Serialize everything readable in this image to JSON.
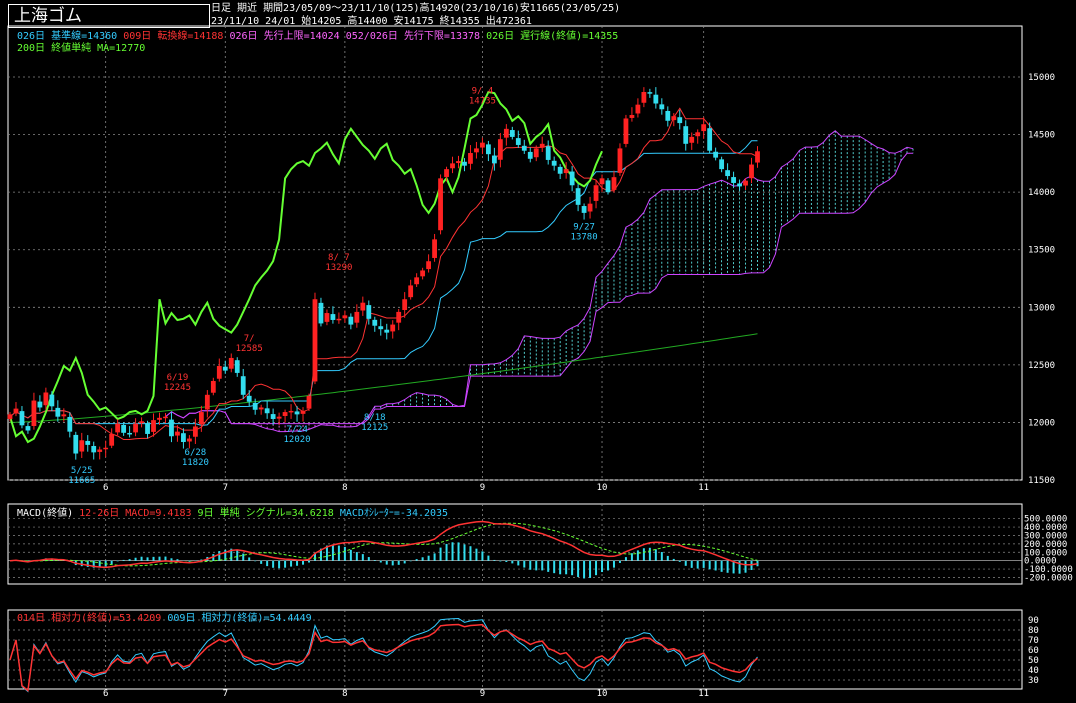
{
  "header": {
    "title": "上海ゴム",
    "period_label": "日足",
    "contract": "期近",
    "range": "期間23/05/09〜23/11/10(125)",
    "high": "高14920(23/10/16)",
    "low": "安11665(23/05/25)",
    "last_bar": "23/11/10 24/01 始14205 高14400 安14175 終14355 出472361"
  },
  "legend_main": [
    {
      "text": "026日 基準線=14360",
      "color": "#33ccff"
    },
    {
      "text": "009日 転換線=14188",
      "color": "#ff3333"
    },
    {
      "text": "026日 先行上限=14024",
      "color": "#ff66ff"
    },
    {
      "text": "052/026日 先行下限=13378",
      "color": "#ff66ff"
    },
    {
      "text": "026日 遅行線(終値)=14355",
      "color": "#66ff33"
    }
  ],
  "legend_main2": {
    "text": "200日 終値単純 MA=12770",
    "color": "#66ff33"
  },
  "legend_macd": [
    {
      "text": "MACD(終値)",
      "color": "#ffffff"
    },
    {
      "text": "12-26日 MACD=9.4183",
      "color": "#ff3333"
    },
    {
      "text": "9日 単純 シグナル=34.6218",
      "color": "#66ff33"
    },
    {
      "text": "MACDｵｼﾚｰﾀｰ=-34.2035",
      "color": "#33ccff"
    }
  ],
  "legend_rsi": [
    {
      "text": "014日 相対力(終値)=53.4209",
      "color": "#ff3333"
    },
    {
      "text": "009日 相対力(終値)=54.4449",
      "color": "#33ccff"
    }
  ],
  "colors": {
    "up": "#ff2222",
    "down": "#33ddee",
    "kijun": "#33ccff",
    "tenkan": "#ff3333",
    "cloud": "#cc44ff",
    "chikou": "#66ff33",
    "ma": "#22aa22",
    "grid": "#888888"
  },
  "chart_data": [
    {
      "type": "candlestick",
      "title": "上海ゴム",
      "x_month_ticks": [
        "6",
        "7",
        "8",
        "9",
        "10",
        "11"
      ],
      "ylim": [
        11500,
        15200
      ],
      "y_ticks": [
        11500,
        12000,
        12500,
        13000,
        13500,
        14000,
        14500,
        15000
      ],
      "grid": true,
      "annotations": [
        {
          "date": "5/25",
          "value": 11665,
          "label": "5/25",
          "sub": "11665"
        },
        {
          "date": "6/28",
          "value": 11820,
          "label": "6/28",
          "sub": "11820"
        },
        {
          "date": "7/24",
          "value": 12020,
          "label": "7/24",
          "sub": "12020"
        },
        {
          "date": "8/18",
          "value": 12125,
          "label": "8/18",
          "sub": "12125"
        },
        {
          "date": "9/27",
          "value": 13780,
          "label": "9/27",
          "sub": "13780"
        },
        {
          "date": "7/",
          "value": 12585,
          "label": "7/",
          "sub": "12585"
        },
        {
          "date": "6/19",
          "value": 12245,
          "label": "6/19",
          "sub": "12245"
        },
        {
          "date": "8/7",
          "value": 13290,
          "label": "8/ 7",
          "sub": "13290"
        },
        {
          "date": "9/4",
          "value": 14735,
          "label": "9/ 4",
          "sub": "14735"
        }
      ],
      "close": [
        12070,
        12120,
        11975,
        11930,
        12190,
        12130,
        12260,
        12140,
        12050,
        12070,
        11920,
        11730,
        11845,
        11805,
        11740,
        11765,
        11780,
        11900,
        11990,
        11910,
        11900,
        11990,
        12010,
        11900,
        12020,
        12040,
        12050,
        11880,
        11920,
        11830,
        11860,
        11965,
        12090,
        12240,
        12360,
        12490,
        12450,
        12560,
        12430,
        12240,
        12180,
        12110,
        12130,
        12080,
        12030,
        12050,
        12090,
        12100,
        12070,
        12100,
        12230,
        13070,
        12860,
        12950,
        12890,
        12900,
        12930,
        12850,
        12960,
        13040,
        12900,
        12840,
        12810,
        12780,
        12850,
        12960,
        13070,
        13190,
        13260,
        13320,
        13400,
        13590,
        14120,
        14200,
        14250,
        14270,
        14230,
        14340,
        14380,
        14430,
        14330,
        14250,
        14460,
        14550,
        14480,
        14410,
        14360,
        14290,
        14380,
        14420,
        14280,
        14230,
        14160,
        14200,
        14060,
        13890,
        13820,
        13900,
        14060,
        14120,
        14000,
        14130,
        14380,
        14640,
        14670,
        14760,
        14870,
        14860,
        14770,
        14720,
        14620,
        14660,
        14600,
        14420,
        14480,
        14520,
        14590,
        14360,
        14300,
        14200,
        14140,
        14080,
        14050,
        14100,
        14240,
        14355
      ],
      "series": [
        {
          "name": "026日 基準線",
          "last": 14360
        },
        {
          "name": "009日 転換線",
          "last": 14188
        },
        {
          "name": "026日 先行上限",
          "last": 14024
        },
        {
          "name": "052/026日 先行下限",
          "last": 13378
        },
        {
          "name": "026日 遅行線(終値)",
          "last": 14355
        },
        {
          "name": "200日 終値単純 MA",
          "last": 12770
        }
      ]
    },
    {
      "type": "line",
      "title": "MACD(終値)",
      "ylim": [
        -230,
        520
      ],
      "y_ticks": [
        500,
        400,
        300,
        200,
        100,
        0,
        -100,
        -200
      ],
      "y_tick_labels": [
        "500.0000",
        "400.0000",
        "300.0000",
        "200.0000",
        "100.0000",
        "0.0000",
        "-100.0000",
        "-200.0000"
      ],
      "series": [
        {
          "name": "12-26日 MACD",
          "last": 9.4183
        },
        {
          "name": "9日 単純 シグナル",
          "last": 34.6218
        },
        {
          "name": "MACDｵｼﾚｰﾀｰ",
          "last": -34.2035
        }
      ]
    },
    {
      "type": "line",
      "title": "相対力",
      "ylim": [
        25,
        93
      ],
      "y_ticks": [
        90,
        80,
        70,
        60,
        50,
        40,
        30
      ],
      "series": [
        {
          "name": "014日 相対力(終値)",
          "last": 53.4209
        },
        {
          "name": "009日 相対力(終値)",
          "last": 54.4449
        }
      ]
    }
  ]
}
